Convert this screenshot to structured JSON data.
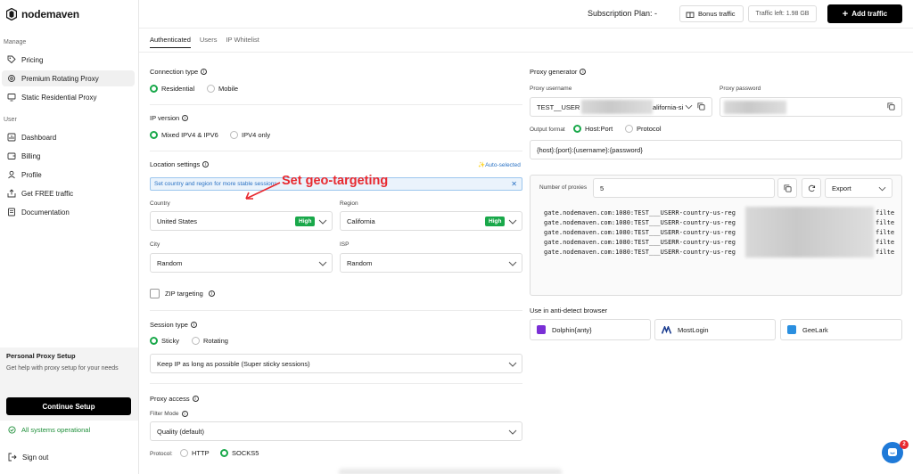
{
  "brand": {
    "name": "nodemaven",
    "accent": "#19a84a",
    "annotation_color": "#e8292f"
  },
  "sidebar": {
    "manage_label": "Manage",
    "user_label": "User",
    "manage_items": [
      {
        "label": "Pricing",
        "icon": "tag-icon"
      },
      {
        "label": "Premium Rotating Proxy",
        "icon": "gear-icon"
      },
      {
        "label": "Static Residential Proxy",
        "icon": "monitor-icon"
      }
    ],
    "user_items": [
      {
        "label": "Dashboard",
        "icon": "chart-icon"
      },
      {
        "label": "Billing",
        "icon": "wallet-icon"
      },
      {
        "label": "Profile",
        "icon": "user-icon"
      },
      {
        "label": "Get FREE traffic",
        "icon": "share-icon"
      },
      {
        "label": "Documentation",
        "icon": "doc-icon"
      }
    ],
    "setup": {
      "title": "Personal Proxy Setup",
      "desc": "Get help with proxy setup for your needs",
      "button": "Continue Setup"
    },
    "status": "All systems operational",
    "signout": "Sign out"
  },
  "topbar": {
    "plan": "Subscription Plan: -",
    "bonus": "Bonus traffic",
    "traffic_left": "Traffic left: 1.98 GB",
    "add_traffic": "Add traffic"
  },
  "tabs": [
    "Authenticated",
    "Users",
    "IP Whitelist"
  ],
  "connection": {
    "label": "Connection type",
    "options": [
      "Residential",
      "Mobile"
    ]
  },
  "ip_version": {
    "label": "IP version",
    "options": [
      "Mixed IPV4 & IPV6",
      "IPV4 only"
    ]
  },
  "location": {
    "label": "Location settings",
    "auto_selected": "Auto-selected",
    "hint": "Set country and region for more stable sessions",
    "annotation": "Set geo-targeting",
    "country_label": "Country",
    "country": "United States",
    "region_label": "Region",
    "region": "California",
    "high": "High",
    "city_label": "City",
    "city": "Random",
    "isp_label": "ISP",
    "isp": "Random",
    "zip_label": "ZIP targeting"
  },
  "session": {
    "label": "Session type",
    "options": [
      "Sticky",
      "Rotating"
    ],
    "value": "Keep IP as long as possible (Super sticky sessions)"
  },
  "access": {
    "label": "Proxy access",
    "filter_label": "Filter Mode",
    "filter": "Quality (default)",
    "protocol_label": "Protocol:",
    "protocols": [
      "HTTP",
      "SOCKS5"
    ]
  },
  "generator": {
    "label": "Proxy generator",
    "username_label": "Proxy username",
    "username_prefix": "TEST__USER",
    "username_suffix": "alifornia-si",
    "password_label": "Proxy password",
    "output_label": "Output format",
    "formats": [
      "Host:Port",
      "Protocol"
    ],
    "template": "{host}:{port}:{username}:{password}",
    "count_label": "Number of proxies",
    "count": "5",
    "export": "Export",
    "lines": [
      "gate.nodemaven.com:1080:TEST___USERR-country-us-reg",
      "gate.nodemaven.com:1080:TEST___USERR-country-us-reg",
      "gate.nodemaven.com:1080:TEST___USERR-country-us-reg",
      "gate.nodemaven.com:1080:TEST___USERR-country-us-reg",
      "gate.nodemaven.com:1080:TEST___USERR-country-us-reg"
    ],
    "line_tail": "filte"
  },
  "antidetect": {
    "label": "Use in anti-detect browser",
    "browsers": [
      {
        "name": "Dolphin{anty}",
        "color": "#7a2fd6"
      },
      {
        "name": "MostLogin",
        "color": "#1a3c8f"
      },
      {
        "name": "GeeLark",
        "color": "#2a8fe0"
      }
    ]
  },
  "chat": {
    "badge": "2"
  }
}
